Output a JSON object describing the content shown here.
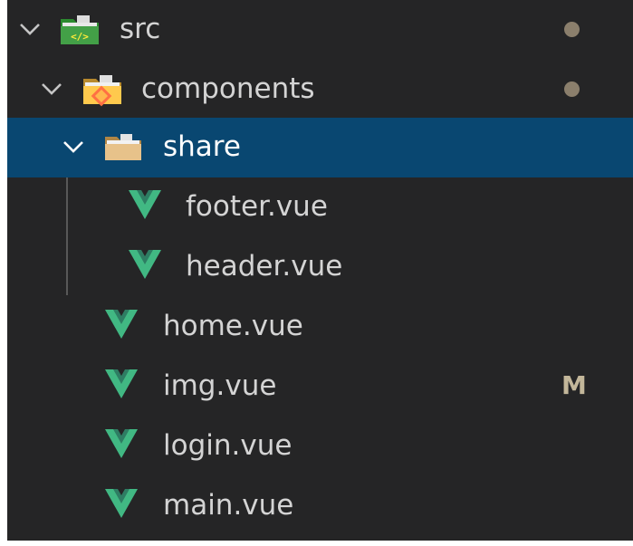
{
  "explorer": {
    "items": [
      {
        "label": "src",
        "icon": "folder-src-icon",
        "twistie": "chevron-down-icon",
        "status": "dot"
      },
      {
        "label": "components",
        "icon": "folder-components-icon",
        "twistie": "chevron-down-icon",
        "status": "dot"
      },
      {
        "label": "share",
        "icon": "folder-icon",
        "twistie": "chevron-down-icon",
        "selected": true
      },
      {
        "label": "footer.vue",
        "icon": "vue-icon"
      },
      {
        "label": "header.vue",
        "icon": "vue-icon"
      },
      {
        "label": "home.vue",
        "icon": "vue-icon"
      },
      {
        "label": "img.vue",
        "icon": "vue-icon",
        "status": "M"
      },
      {
        "label": "login.vue",
        "icon": "vue-icon"
      },
      {
        "label": "main.vue",
        "icon": "vue-icon"
      }
    ]
  },
  "colors": {
    "background": "#252526",
    "selected_row": "#094771",
    "vue_green": "#41b883",
    "status_modified": "#c3b79a"
  }
}
